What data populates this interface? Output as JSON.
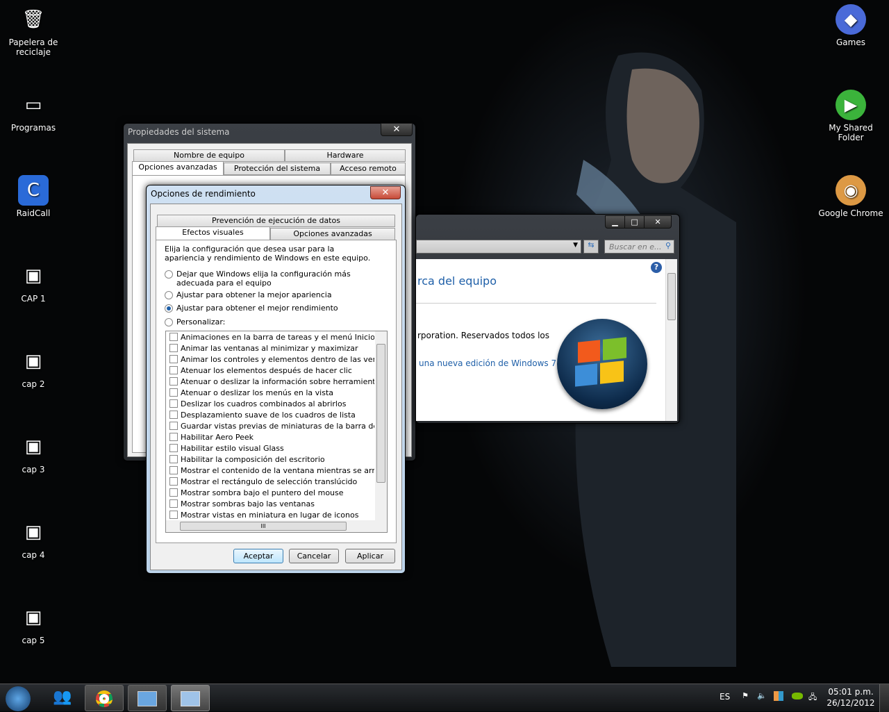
{
  "desktop": {
    "icons_left": [
      {
        "label": "Papelera de reciclaje",
        "icon": "recycle-bin-icon"
      },
      {
        "label": "Programas",
        "icon": "drive-icon"
      },
      {
        "label": "RaidCall",
        "icon": "raidcall-icon"
      },
      {
        "label": "CAP 1",
        "icon": "image-icon"
      },
      {
        "label": "cap 2",
        "icon": "image-icon"
      },
      {
        "label": "cap 3",
        "icon": "image-icon"
      },
      {
        "label": "cap 4",
        "icon": "image-icon"
      },
      {
        "label": "cap 5",
        "icon": "image-icon"
      }
    ],
    "icons_right": [
      {
        "label": "Games",
        "icon": "games-icon"
      },
      {
        "label": "My Shared Folder",
        "icon": "play-icon"
      },
      {
        "label": "Google Chrome",
        "icon": "chrome-icon"
      }
    ]
  },
  "sysprops": {
    "title": "Propiedades del sistema",
    "close": "✕",
    "tabs_row1": [
      "Nombre de equipo",
      "Hardware"
    ],
    "tabs_row2": [
      "Opciones avanzadas",
      "Protección del sistema",
      "Acceso remoto"
    ]
  },
  "explorer": {
    "search_placeholder": "Buscar en e...",
    "heading": "rca del equipo",
    "copyright": "rporation. Reservados todos los",
    "link": "una nueva edición de Windows 7",
    "minimize": "▁",
    "maximize": "□",
    "close": "✕"
  },
  "perf": {
    "title": "Opciones de rendimiento",
    "close": "✕",
    "tab_top": "Prevención de ejecución de datos",
    "tabs": [
      "Efectos visuales",
      "Opciones avanzadas"
    ],
    "intro": "Elija la configuración que desea usar para la apariencia y rendimiento de Windows en este equipo.",
    "radios": [
      {
        "label": "Dejar que Windows elija la configuración más adecuada para el equipo",
        "checked": false
      },
      {
        "label": "Ajustar para obtener la mejor apariencia",
        "checked": false
      },
      {
        "label": "Ajustar para obtener el mejor rendimiento",
        "checked": true
      },
      {
        "label": "Personalizar:",
        "checked": false
      }
    ],
    "effects": [
      "Animaciones en la barra de tareas y el menú Inicio",
      "Animar las ventanas al minimizar y maximizar",
      "Animar los controles y elementos dentro de las ventanas",
      "Atenuar los elementos después de hacer clic",
      "Atenuar o deslizar la información sobre herramientas en la",
      "Atenuar o deslizar los menús en la vista",
      "Deslizar los cuadros combinados al abrirlos",
      "Desplazamiento suave de los cuadros de lista",
      "Guardar vistas previas de miniaturas de la barra de tareas",
      "Habilitar Aero Peek",
      "Habilitar estilo visual Glass",
      "Habilitar la composición del escritorio",
      "Mostrar el contenido de la ventana mientras se arrastra",
      "Mostrar el rectángulo de selección translúcido",
      "Mostrar sombra bajo el puntero del mouse",
      "Mostrar sombras bajo las ventanas",
      "Mostrar vistas en miniatura en lugar de iconos"
    ],
    "hscroll_grip": "III",
    "ok": "Aceptar",
    "cancel": "Cancelar",
    "apply": "Aplicar"
  },
  "taskbar": {
    "lang": "ES",
    "time": "05:01 p.m.",
    "date": "26/12/2012"
  }
}
